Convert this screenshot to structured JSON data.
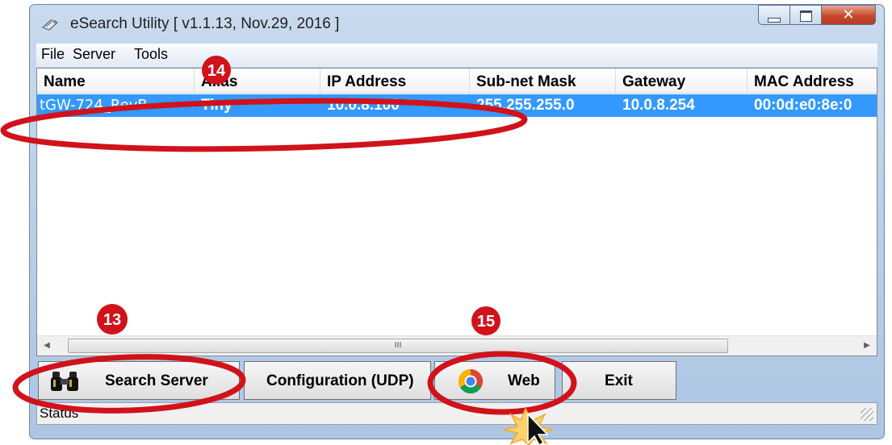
{
  "window": {
    "title": "eSearch Utility [ v1.1.13, Nov.29, 2016 ]"
  },
  "menu": {
    "items": [
      "File",
      "Server",
      "Tools"
    ]
  },
  "table": {
    "columns": [
      "Name",
      "Alias",
      "IP Address",
      "Sub-net Mask",
      "Gateway",
      "MAC Address"
    ],
    "rows": [
      {
        "name": "tGW-724_RevB",
        "alias": "Tiny",
        "ip": "10.0.8.100",
        "mask": "255.255.255.0",
        "gateway": "10.0.8.254",
        "mac": "00:0d:e0:8e:0"
      }
    ],
    "scroll_thumb_glyph": "III"
  },
  "buttons": {
    "search": "Search Server",
    "config": "Configuration (UDP)",
    "web": "Web",
    "exit": "Exit"
  },
  "status": {
    "text": "Status"
  },
  "annotations": {
    "step13": "13",
    "step14": "14",
    "step15": "15"
  },
  "colors": {
    "selection": "#3399ff",
    "annotation": "#d0121b",
    "title_bar": "#b9cfe9"
  },
  "icons": {
    "app": "network-icon",
    "search": "binoculars-icon",
    "web": "chrome-icon",
    "cursor": "mouse-pointer-icon"
  }
}
